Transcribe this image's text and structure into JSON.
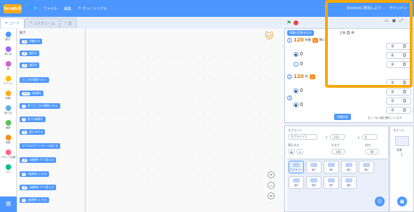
{
  "topbar": {
    "logo": "Scratch",
    "language_icon": "globe-icon",
    "file_menu": "ファイル",
    "edit_menu": "編集",
    "tutorials": "チュートリアル",
    "join": "Scratchに参加しよう",
    "signin": "サインイン"
  },
  "tabs": {
    "code": "コード",
    "costumes": "コスチューム",
    "sounds": "音"
  },
  "categories": [
    {
      "label": "動き",
      "color": "#4c97ff"
    },
    {
      "label": "見た目",
      "color": "#9966ff"
    },
    {
      "label": "音",
      "color": "#cf63cf"
    },
    {
      "label": "イベント",
      "color": "#ffbf00"
    },
    {
      "label": "制御",
      "color": "#ffab19"
    },
    {
      "label": "調べる",
      "color": "#5cb1d6"
    },
    {
      "label": "演算",
      "color": "#59c059"
    },
    {
      "label": "変数",
      "color": "#ff8c1a"
    },
    {
      "label": "ブロック定義",
      "color": "#ff6680"
    },
    {
      "label": "ペン",
      "color": "#0fbd8c"
    }
  ],
  "palette": {
    "section": "動き",
    "blocks": [
      {
        "text": "歩動かす",
        "pill": "10"
      },
      {
        "text": "度回す",
        "pill": "15"
      },
      {
        "text": "度回す",
        "pill": "15"
      },
      {
        "text": "どこかの場所へ行く",
        "pill": ""
      },
      {
        "text": "x座標を",
        "pill": "-240"
      },
      {
        "text": "秒でどこかの場所へ行く",
        "pill": "1"
      },
      {
        "text": "秒でx座標を",
        "pill": "1"
      },
      {
        "text": "度に向ける",
        "pill": "90"
      },
      {
        "text": "マウスのポインターへ向ける",
        "pill": ""
      },
      {
        "text": "x座標を ずつ変える",
        "pill": "10"
      },
      {
        "text": "x座標を にする",
        "pill": "0"
      },
      {
        "text": "y座標を ずつ変える",
        "pill": "10"
      },
      {
        "text": "y座標を にする",
        "pill": "0"
      }
    ]
  },
  "stage": {
    "header_button": "問題の回答を見る",
    "score_label": "正答",
    "score_value": "0",
    "total_label": "問",
    "q1_num": "1",
    "q1_text": "120",
    "q1_suffix": "秒間",
    "q1_end": "問いて",
    "q2_num": "2",
    "q2_text": "120",
    "q2_suffix": "秒",
    "q3_num": "3",
    "ok_button": "問題回答",
    "value_label": "値",
    "value": "0",
    "bottom_note": "正しくない値を選択しています"
  },
  "sprite_panel": {
    "title": "スプライト",
    "name_value": "スプライト1",
    "x_label": "x",
    "x_value": "-213",
    "y_label": "y",
    "y_value": "0",
    "show_label": "表示する",
    "size_label": "大きさ",
    "size_value": "100",
    "direction_label": "向き",
    "direction_value": "90",
    "thumbs": [
      "スプライト",
      "値1",
      "値2",
      "値3",
      "値4",
      "値5",
      "値6",
      "値7",
      "値8"
    ]
  },
  "stage_panel": {
    "title": "ステージ",
    "backdrops_label": "背景",
    "backdrops_count": "1"
  }
}
